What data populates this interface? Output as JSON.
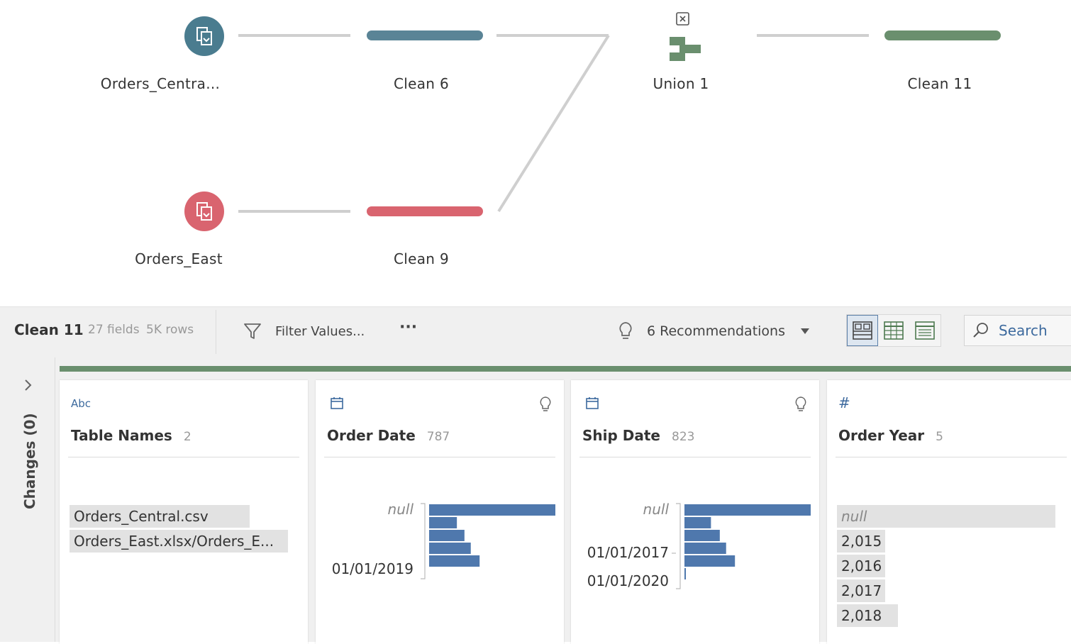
{
  "flow": {
    "nodes": [
      {
        "id": "orders_central",
        "label": "Orders_Centra...",
        "kind": "input",
        "color": "#4a7c8f"
      },
      {
        "id": "clean6",
        "label": "Clean 6",
        "kind": "clean",
        "color": "#5a8496"
      },
      {
        "id": "union1",
        "label": "Union 1",
        "kind": "union",
        "color": "#6a8f6e"
      },
      {
        "id": "clean11",
        "label": "Clean 11",
        "kind": "clean",
        "color": "#6a8f6e"
      },
      {
        "id": "orders_east",
        "label": "Orders_East",
        "kind": "input",
        "color": "#d9646f"
      },
      {
        "id": "clean9",
        "label": "Clean 9",
        "kind": "clean",
        "color": "#d9646f"
      }
    ]
  },
  "toolbar": {
    "step_name": "Clean 11",
    "fields": "27 fields",
    "rows": "5K rows",
    "filter_label": "Filter Values...",
    "more_label": "···",
    "recommendations_label": "6 Recommendations",
    "search_label": "Search"
  },
  "changes": {
    "label": "Changes (0)"
  },
  "colors": {
    "accent": "#3d6a9e",
    "bar": "#4f78ad",
    "step": "#6a8f6e"
  },
  "profile": [
    {
      "type_icon": "Abc",
      "name": "Table Names",
      "count": "2",
      "values": [
        "Orders_Central.csv",
        "Orders_East.xlsx/Orders_E..."
      ]
    },
    {
      "type_icon": "calendar-icon",
      "name": "Order Date",
      "count": "787",
      "labels": [
        "null",
        "01/01/2019"
      ],
      "bins": [
        1.0,
        0.22,
        0.28,
        0.33,
        0.4
      ]
    },
    {
      "type_icon": "calendar-icon",
      "name": "Ship Date",
      "count": "823",
      "labels": [
        "null",
        "01/01/2017",
        "01/01/2020"
      ],
      "bins": [
        1.0,
        0.21,
        0.28,
        0.33,
        0.4,
        0.01
      ]
    },
    {
      "type_icon": "#",
      "name": "Order Year",
      "count": "5",
      "values": [
        "null",
        "2,015",
        "2,016",
        "2,017",
        "2,018"
      ],
      "shares": [
        1.0,
        0.22,
        0.22,
        0.22,
        0.28
      ]
    }
  ]
}
